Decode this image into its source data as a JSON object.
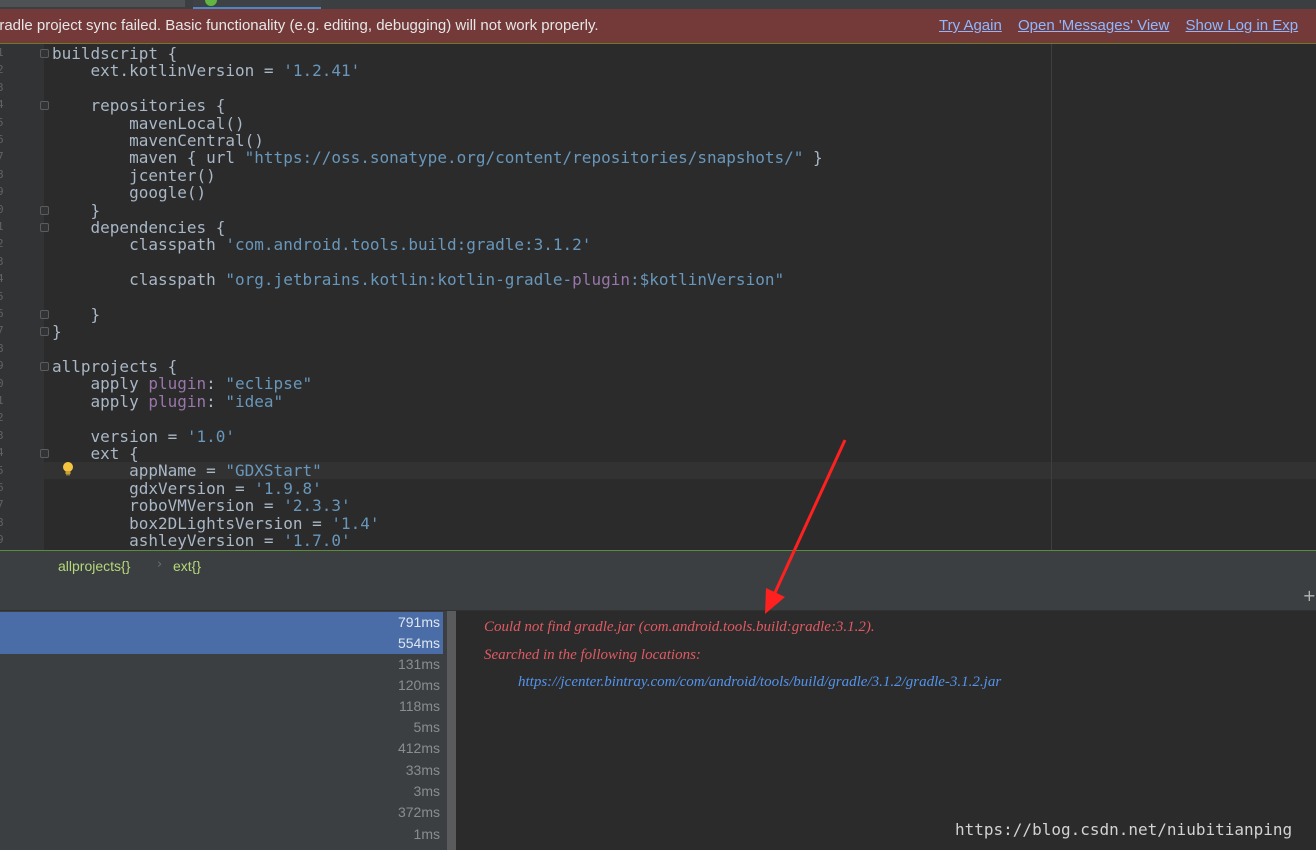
{
  "banner": {
    "message": "iradle project sync failed. Basic functionality (e.g. editing, debugging) will not work properly.",
    "links": [
      "Try Again",
      "Open 'Messages' View",
      "Show Log in Exp"
    ]
  },
  "code_lines": [
    "buildscript {",
    "    ext.kotlinVersion = '1.2.41'",
    "",
    "    repositories {",
    "        mavenLocal()",
    "        mavenCentral()",
    "        maven { url \"https://oss.sonatype.org/content/repositories/snapshots/\" }",
    "        jcenter()",
    "        google()",
    "    }",
    "    dependencies {",
    "        classpath 'com.android.tools.build:gradle:3.1.2'",
    "",
    "        classpath \"org.jetbrains.kotlin:kotlin-gradle-plugin:$kotlinVersion\"",
    "",
    "    }",
    "}",
    "",
    "allprojects {",
    "    apply plugin: \"eclipse\"",
    "    apply plugin: \"idea\"",
    "",
    "    version = '1.0'",
    "    ext {",
    "        appName = \"GDXStart\"",
    "        gdxVersion = '1.9.8'",
    "        roboVMVersion = '2.3.3'",
    "        box2DLightsVersion = '1.4'",
    "        ashleyVersion = '1.7.0'"
  ],
  "breadcrumbs": [
    "allprojects{}",
    "ext{}"
  ],
  "timings": [
    "791ms",
    "554ms",
    "131ms",
    "120ms",
    "118ms",
    "5ms",
    "412ms",
    "33ms",
    "3ms",
    "372ms",
    "1ms"
  ],
  "console": {
    "error_line": "Could not find gradle.jar (com.android.tools.build:gradle:3.1.2).",
    "searched_line": "Searched in the following locations:",
    "location_url": "https://jcenter.bintray.com/com/android/tools/build/gradle/3.1.2/gradle-3.1.2.jar"
  },
  "watermark": "https://blog.csdn.net/niubitianping",
  "colors": {
    "error_banner": "#743a3a",
    "selection": "#4a6da7",
    "error_text": "#e05a63",
    "link": "#5394ec",
    "annotation_arrow": "#ff2020"
  }
}
